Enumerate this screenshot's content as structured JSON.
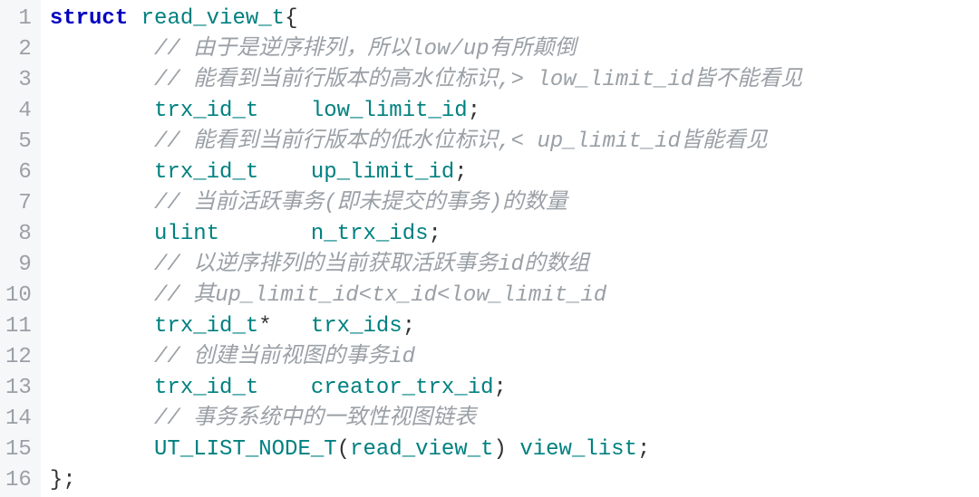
{
  "lines": [
    {
      "no": "1",
      "segs": [
        {
          "cls": "kw",
          "t": "struct"
        },
        {
          "cls": "plain",
          "t": " "
        },
        {
          "cls": "ident",
          "t": "read_view_t"
        },
        {
          "cls": "plain",
          "t": "{"
        }
      ]
    },
    {
      "no": "2",
      "indent": 2,
      "segs": [
        {
          "cls": "comment",
          "t": "// 由于是逆序排列，所以low/up有所颠倒"
        }
      ]
    },
    {
      "no": "3",
      "indent": 2,
      "segs": [
        {
          "cls": "comment",
          "t": "// 能看到当前行版本的高水位标识,> low_limit_id皆不能看见"
        }
      ]
    },
    {
      "no": "4",
      "indent": 2,
      "segs": [
        {
          "cls": "ident",
          "t": "trx_id_t"
        },
        {
          "cls": "plain",
          "t": "    "
        },
        {
          "cls": "ident",
          "t": "low_limit_id"
        },
        {
          "cls": "plain",
          "t": ";"
        }
      ]
    },
    {
      "no": "5",
      "indent": 2,
      "segs": [
        {
          "cls": "comment",
          "t": "// 能看到当前行版本的低水位标识,< up_limit_id皆能看见"
        }
      ]
    },
    {
      "no": "6",
      "indent": 2,
      "segs": [
        {
          "cls": "ident",
          "t": "trx_id_t"
        },
        {
          "cls": "plain",
          "t": "    "
        },
        {
          "cls": "ident",
          "t": "up_limit_id"
        },
        {
          "cls": "plain",
          "t": ";"
        }
      ]
    },
    {
      "no": "7",
      "indent": 2,
      "segs": [
        {
          "cls": "comment",
          "t": "// 当前活跃事务(即未提交的事务)的数量"
        }
      ]
    },
    {
      "no": "8",
      "indent": 2,
      "segs": [
        {
          "cls": "ident",
          "t": "ulint"
        },
        {
          "cls": "plain",
          "t": "       "
        },
        {
          "cls": "ident",
          "t": "n_trx_ids"
        },
        {
          "cls": "plain",
          "t": ";"
        }
      ]
    },
    {
      "no": "9",
      "indent": 2,
      "segs": [
        {
          "cls": "comment",
          "t": "// 以逆序排列的当前获取活跃事务id的数组"
        }
      ]
    },
    {
      "no": "10",
      "indent": 2,
      "segs": [
        {
          "cls": "comment",
          "t": "// 其up_limit_id<tx_id<low_limit_id"
        }
      ]
    },
    {
      "no": "11",
      "indent": 2,
      "segs": [
        {
          "cls": "ident",
          "t": "trx_id_t"
        },
        {
          "cls": "plain",
          "t": "*   "
        },
        {
          "cls": "ident",
          "t": "trx_ids"
        },
        {
          "cls": "plain",
          "t": ";"
        }
      ]
    },
    {
      "no": "12",
      "indent": 2,
      "segs": [
        {
          "cls": "comment",
          "t": "// 创建当前视图的事务id"
        }
      ]
    },
    {
      "no": "13",
      "indent": 2,
      "segs": [
        {
          "cls": "ident",
          "t": "trx_id_t"
        },
        {
          "cls": "plain",
          "t": "    "
        },
        {
          "cls": "ident",
          "t": "creator_trx_id"
        },
        {
          "cls": "plain",
          "t": ";"
        }
      ]
    },
    {
      "no": "14",
      "indent": 2,
      "segs": [
        {
          "cls": "comment",
          "t": "// 事务系统中的一致性视图链表"
        }
      ]
    },
    {
      "no": "15",
      "indent": 2,
      "segs": [
        {
          "cls": "ident",
          "t": "UT_LIST_NODE_T"
        },
        {
          "cls": "plain",
          "t": "("
        },
        {
          "cls": "ident",
          "t": "read_view_t"
        },
        {
          "cls": "plain",
          "t": ") "
        },
        {
          "cls": "ident",
          "t": "view_list"
        },
        {
          "cls": "plain",
          "t": ";"
        }
      ]
    },
    {
      "no": "16",
      "segs": [
        {
          "cls": "plain",
          "t": "};"
        }
      ]
    }
  ]
}
